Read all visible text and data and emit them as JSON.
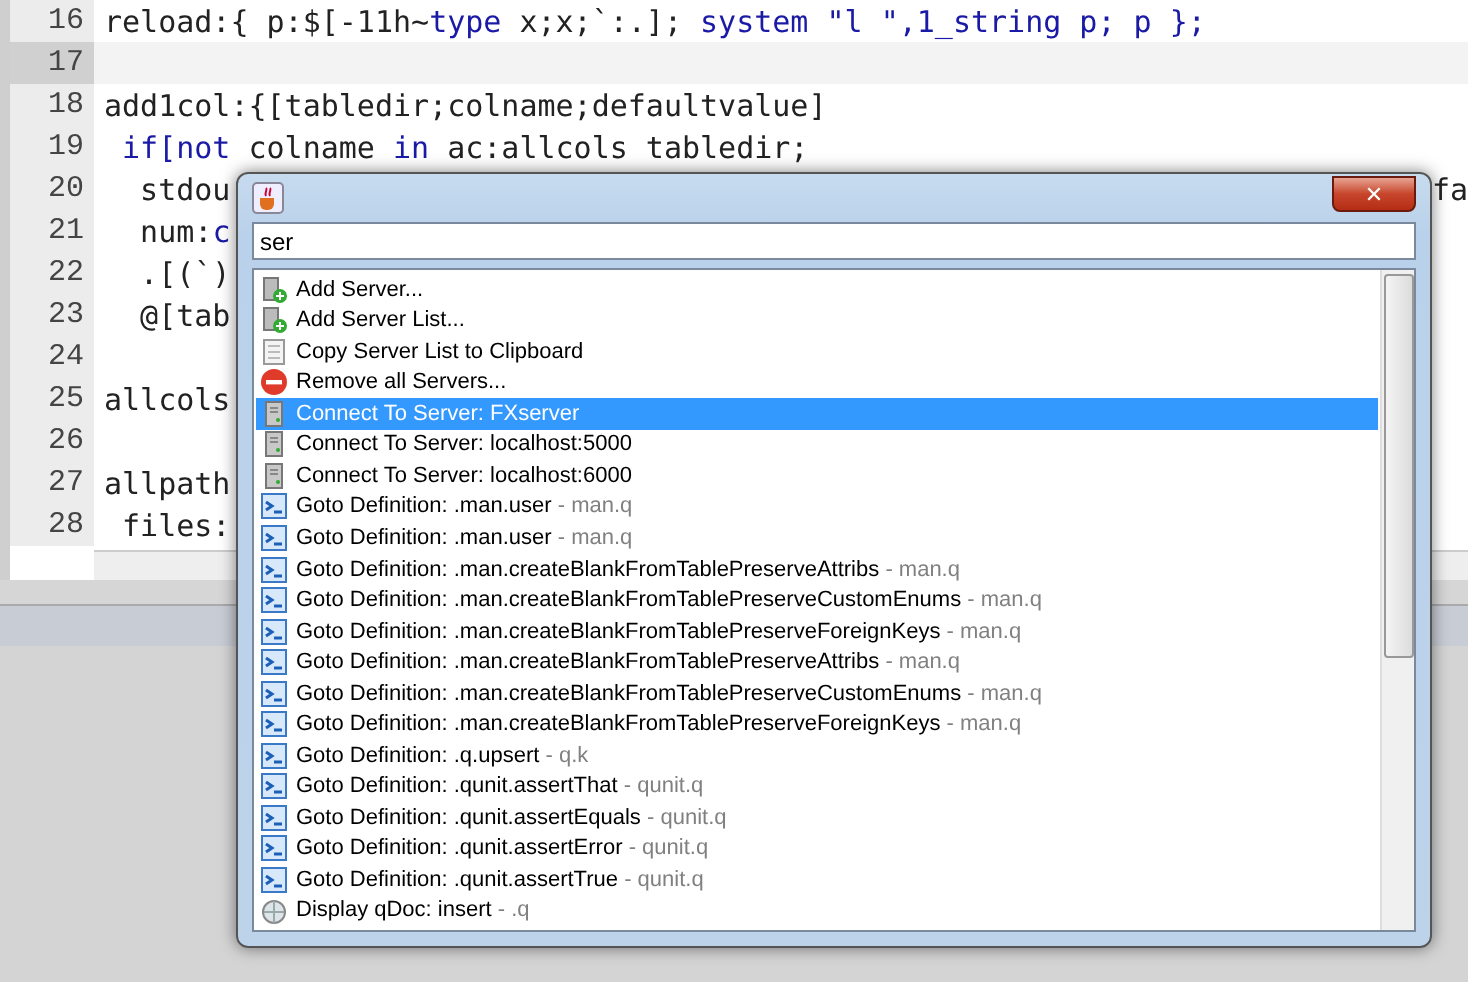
{
  "editor": {
    "lines": [
      {
        "number": "16",
        "current": false,
        "tokens": [
          {
            "text": "reload:{ p:$[-11h~",
            "kind": "plain"
          },
          {
            "text": "type",
            "kind": "keyword"
          },
          {
            "text": " x;x;`:.]; ",
            "kind": "plain"
          },
          {
            "text": "system \"l \",1_string p; p };",
            "kind": "keyword"
          }
        ]
      },
      {
        "number": "17",
        "current": true
      },
      {
        "number": "18",
        "current": false,
        "tokens": [
          {
            "text": "add1col:{[tabledir;colname;defaultvalue]",
            "kind": "plain"
          }
        ]
      },
      {
        "number": "19",
        "current": false,
        "tokens": [
          {
            "text": " if[not",
            "kind": "keyword"
          },
          {
            "text": " colname ",
            "kind": "plain"
          },
          {
            "text": "in",
            "kind": "keyword"
          },
          {
            "text": " ac:allcols tabledir;",
            "kind": "plain"
          }
        ]
      },
      {
        "number": "20",
        "current": false,
        "tokens": [
          {
            "text": "  stdou",
            "kind": "plain"
          }
        ],
        "tail": "fa"
      },
      {
        "number": "21",
        "current": false,
        "tokens": [
          {
            "text": "  num:",
            "kind": "plain"
          },
          {
            "text": "c",
            "kind": "keyword"
          }
        ]
      },
      {
        "number": "22",
        "current": false,
        "tokens": [
          {
            "text": "  .[(`)",
            "kind": "plain"
          }
        ]
      },
      {
        "number": "23",
        "current": false,
        "tokens": [
          {
            "text": "  @[tab",
            "kind": "plain"
          }
        ]
      },
      {
        "number": "24",
        "current": false
      },
      {
        "number": "25",
        "current": false,
        "tokens": [
          {
            "text": "allcols",
            "kind": "plain"
          }
        ]
      },
      {
        "number": "26",
        "current": false
      },
      {
        "number": "27",
        "current": false,
        "tokens": [
          {
            "text": "allpath",
            "kind": "plain"
          }
        ]
      },
      {
        "number": "28",
        "current": false,
        "tokens": [
          {
            "text": " files:",
            "kind": "plain"
          }
        ]
      }
    ]
  },
  "dialog": {
    "search": {
      "value": "ser"
    },
    "close": "✕",
    "items": [
      {
        "kind": "add-server",
        "label": "Add Server...",
        "selected": false
      },
      {
        "kind": "add-server",
        "label": "Add Server List...",
        "selected": false
      },
      {
        "kind": "document",
        "label": "Copy Server List to Clipboard",
        "selected": false
      },
      {
        "kind": "remove",
        "label": "Remove all Servers...",
        "selected": false
      },
      {
        "kind": "server",
        "label": "Connect To Server: FXserver",
        "selected": true
      },
      {
        "kind": "server",
        "label": "Connect To Server: localhost:5000",
        "selected": false
      },
      {
        "kind": "server",
        "label": "Connect To Server: localhost:6000",
        "selected": false
      },
      {
        "kind": "goto",
        "label": "Goto Definition: .man.user",
        "source": "- man.q",
        "selected": false
      },
      {
        "kind": "goto",
        "label": "Goto Definition: .man.user",
        "source": "- man.q",
        "selected": false
      },
      {
        "kind": "goto",
        "label": "Goto Definition: .man.createBlankFromTablePreserveAttribs",
        "source": "- man.q",
        "selected": false
      },
      {
        "kind": "goto",
        "label": "Goto Definition: .man.createBlankFromTablePreserveCustomEnums",
        "source": "- man.q",
        "selected": false
      },
      {
        "kind": "goto",
        "label": "Goto Definition: .man.createBlankFromTablePreserveForeignKeys",
        "source": "- man.q",
        "selected": false
      },
      {
        "kind": "goto",
        "label": "Goto Definition: .man.createBlankFromTablePreserveAttribs",
        "source": "- man.q",
        "selected": false
      },
      {
        "kind": "goto",
        "label": "Goto Definition: .man.createBlankFromTablePreserveCustomEnums",
        "source": "- man.q",
        "selected": false
      },
      {
        "kind": "goto",
        "label": "Goto Definition: .man.createBlankFromTablePreserveForeignKeys",
        "source": "- man.q",
        "selected": false
      },
      {
        "kind": "goto",
        "label": "Goto Definition: .q.upsert",
        "source": "- q.k",
        "selected": false
      },
      {
        "kind": "goto",
        "label": "Goto Definition: .qunit.assertThat",
        "source": "- qunit.q",
        "selected": false
      },
      {
        "kind": "goto",
        "label": "Goto Definition: .qunit.assertEquals",
        "source": "- qunit.q",
        "selected": false
      },
      {
        "kind": "goto",
        "label": "Goto Definition: .qunit.assertError",
        "source": "- qunit.q",
        "selected": false
      },
      {
        "kind": "goto",
        "label": "Goto Definition: .qunit.assertTrue",
        "source": "- qunit.q",
        "selected": false
      },
      {
        "kind": "doc",
        "label": "Display qDoc: insert",
        "source": "- .q",
        "selected": false
      }
    ]
  }
}
